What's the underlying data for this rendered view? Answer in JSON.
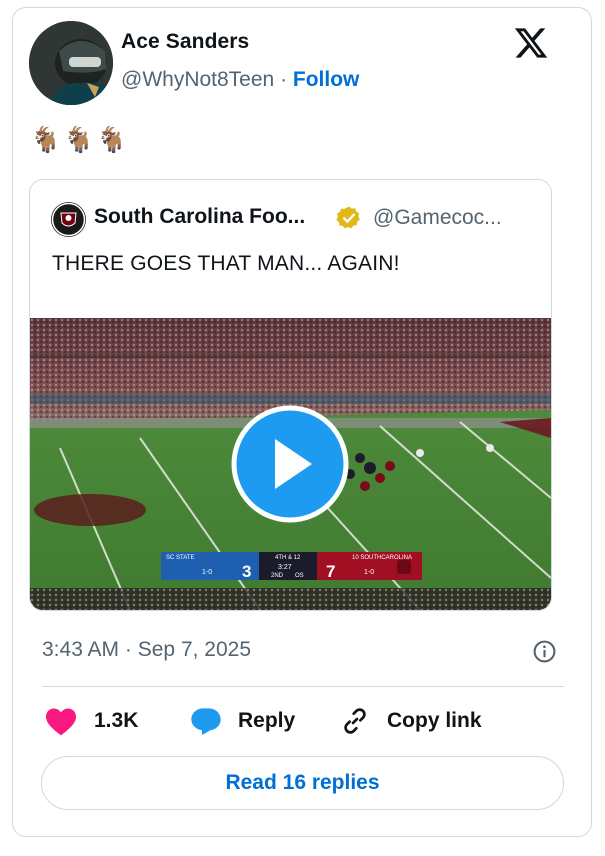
{
  "author": {
    "name": "Ace Sanders",
    "handle": "@WhyNot8Teen",
    "separator": "·",
    "follow_label": "Follow"
  },
  "tweet": {
    "text": "🐐🐐🐐"
  },
  "quoted": {
    "name": "South Carolina Foo...",
    "handle": "@Gamecoc...",
    "text": "THERE GOES THAT MAN... AGAIN!",
    "scorebug": {
      "away_team": "SC STATE",
      "away_score": "3",
      "away_record": "1-0",
      "down_distance": "4TH & 12",
      "clock": "3:27",
      "quarter": "2ND",
      "timeouts": "OS",
      "home_rank_team": "10 SOUTHCAROLINA",
      "home_score": "7",
      "home_record": "1-0"
    }
  },
  "meta": {
    "time": "3:43 AM",
    "separator": "·",
    "date": "Sep 7, 2025"
  },
  "actions": {
    "likes": "1.3K",
    "reply_label": "Reply",
    "copy_label": "Copy link"
  },
  "read_replies": "Read 16 replies",
  "colors": {
    "link": "#006fd6",
    "like": "#f91880",
    "reply": "#1d9bf0",
    "play": "#1d9bf0",
    "verified": "#e2b719",
    "muted": "#536471"
  }
}
